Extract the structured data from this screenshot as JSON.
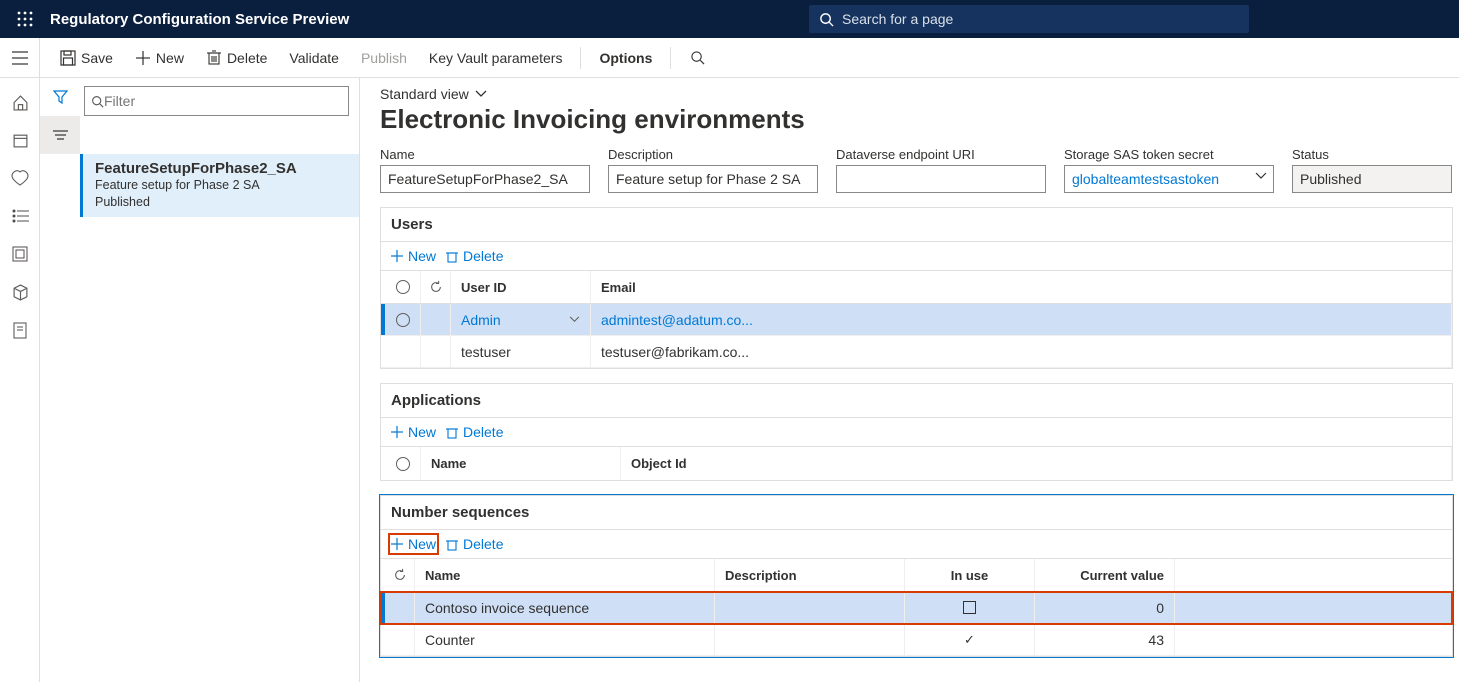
{
  "topbar": {
    "title": "Regulatory Configuration Service Preview",
    "search_placeholder": "Search for a page"
  },
  "commands": {
    "save": "Save",
    "new": "New",
    "delete": "Delete",
    "validate": "Validate",
    "publish": "Publish",
    "kvp": "Key Vault parameters",
    "options": "Options"
  },
  "list": {
    "filter_placeholder": "Filter",
    "item": {
      "title": "FeatureSetupForPhase2_SA",
      "sub1": "Feature setup for Phase 2 SA",
      "sub2": "Published"
    }
  },
  "main": {
    "view": "Standard view",
    "title": "Electronic Invoicing environments",
    "fields": {
      "name_l": "Name",
      "name_v": "FeatureSetupForPhase2_SA",
      "desc_l": "Description",
      "desc_v": "Feature setup for Phase 2 SA",
      "dv_l": "Dataverse endpoint URI",
      "dv_v": "",
      "sas_l": "Storage SAS token secret",
      "sas_v": "globalteamtestsastoken",
      "status_l": "Status",
      "status_v": "Published"
    }
  },
  "users": {
    "header": "Users",
    "new": "New",
    "delete": "Delete",
    "col_userid": "User ID",
    "col_email": "Email",
    "rows": [
      {
        "id": "Admin",
        "email": "admintest@adatum.co..."
      },
      {
        "id": "testuser",
        "email": "testuser@fabrikam.co..."
      }
    ]
  },
  "apps": {
    "header": "Applications",
    "new": "New",
    "delete": "Delete",
    "col_name": "Name",
    "col_obj": "Object Id"
  },
  "numseq": {
    "header": "Number sequences",
    "new": "New",
    "delete": "Delete",
    "col_name": "Name",
    "col_desc": "Description",
    "col_inuse": "In use",
    "col_curr": "Current value",
    "rows": [
      {
        "name": "Contoso invoice sequence",
        "desc": "",
        "inuse": false,
        "current": "0"
      },
      {
        "name": "Counter",
        "desc": "",
        "inuse": true,
        "current": "43"
      }
    ]
  }
}
